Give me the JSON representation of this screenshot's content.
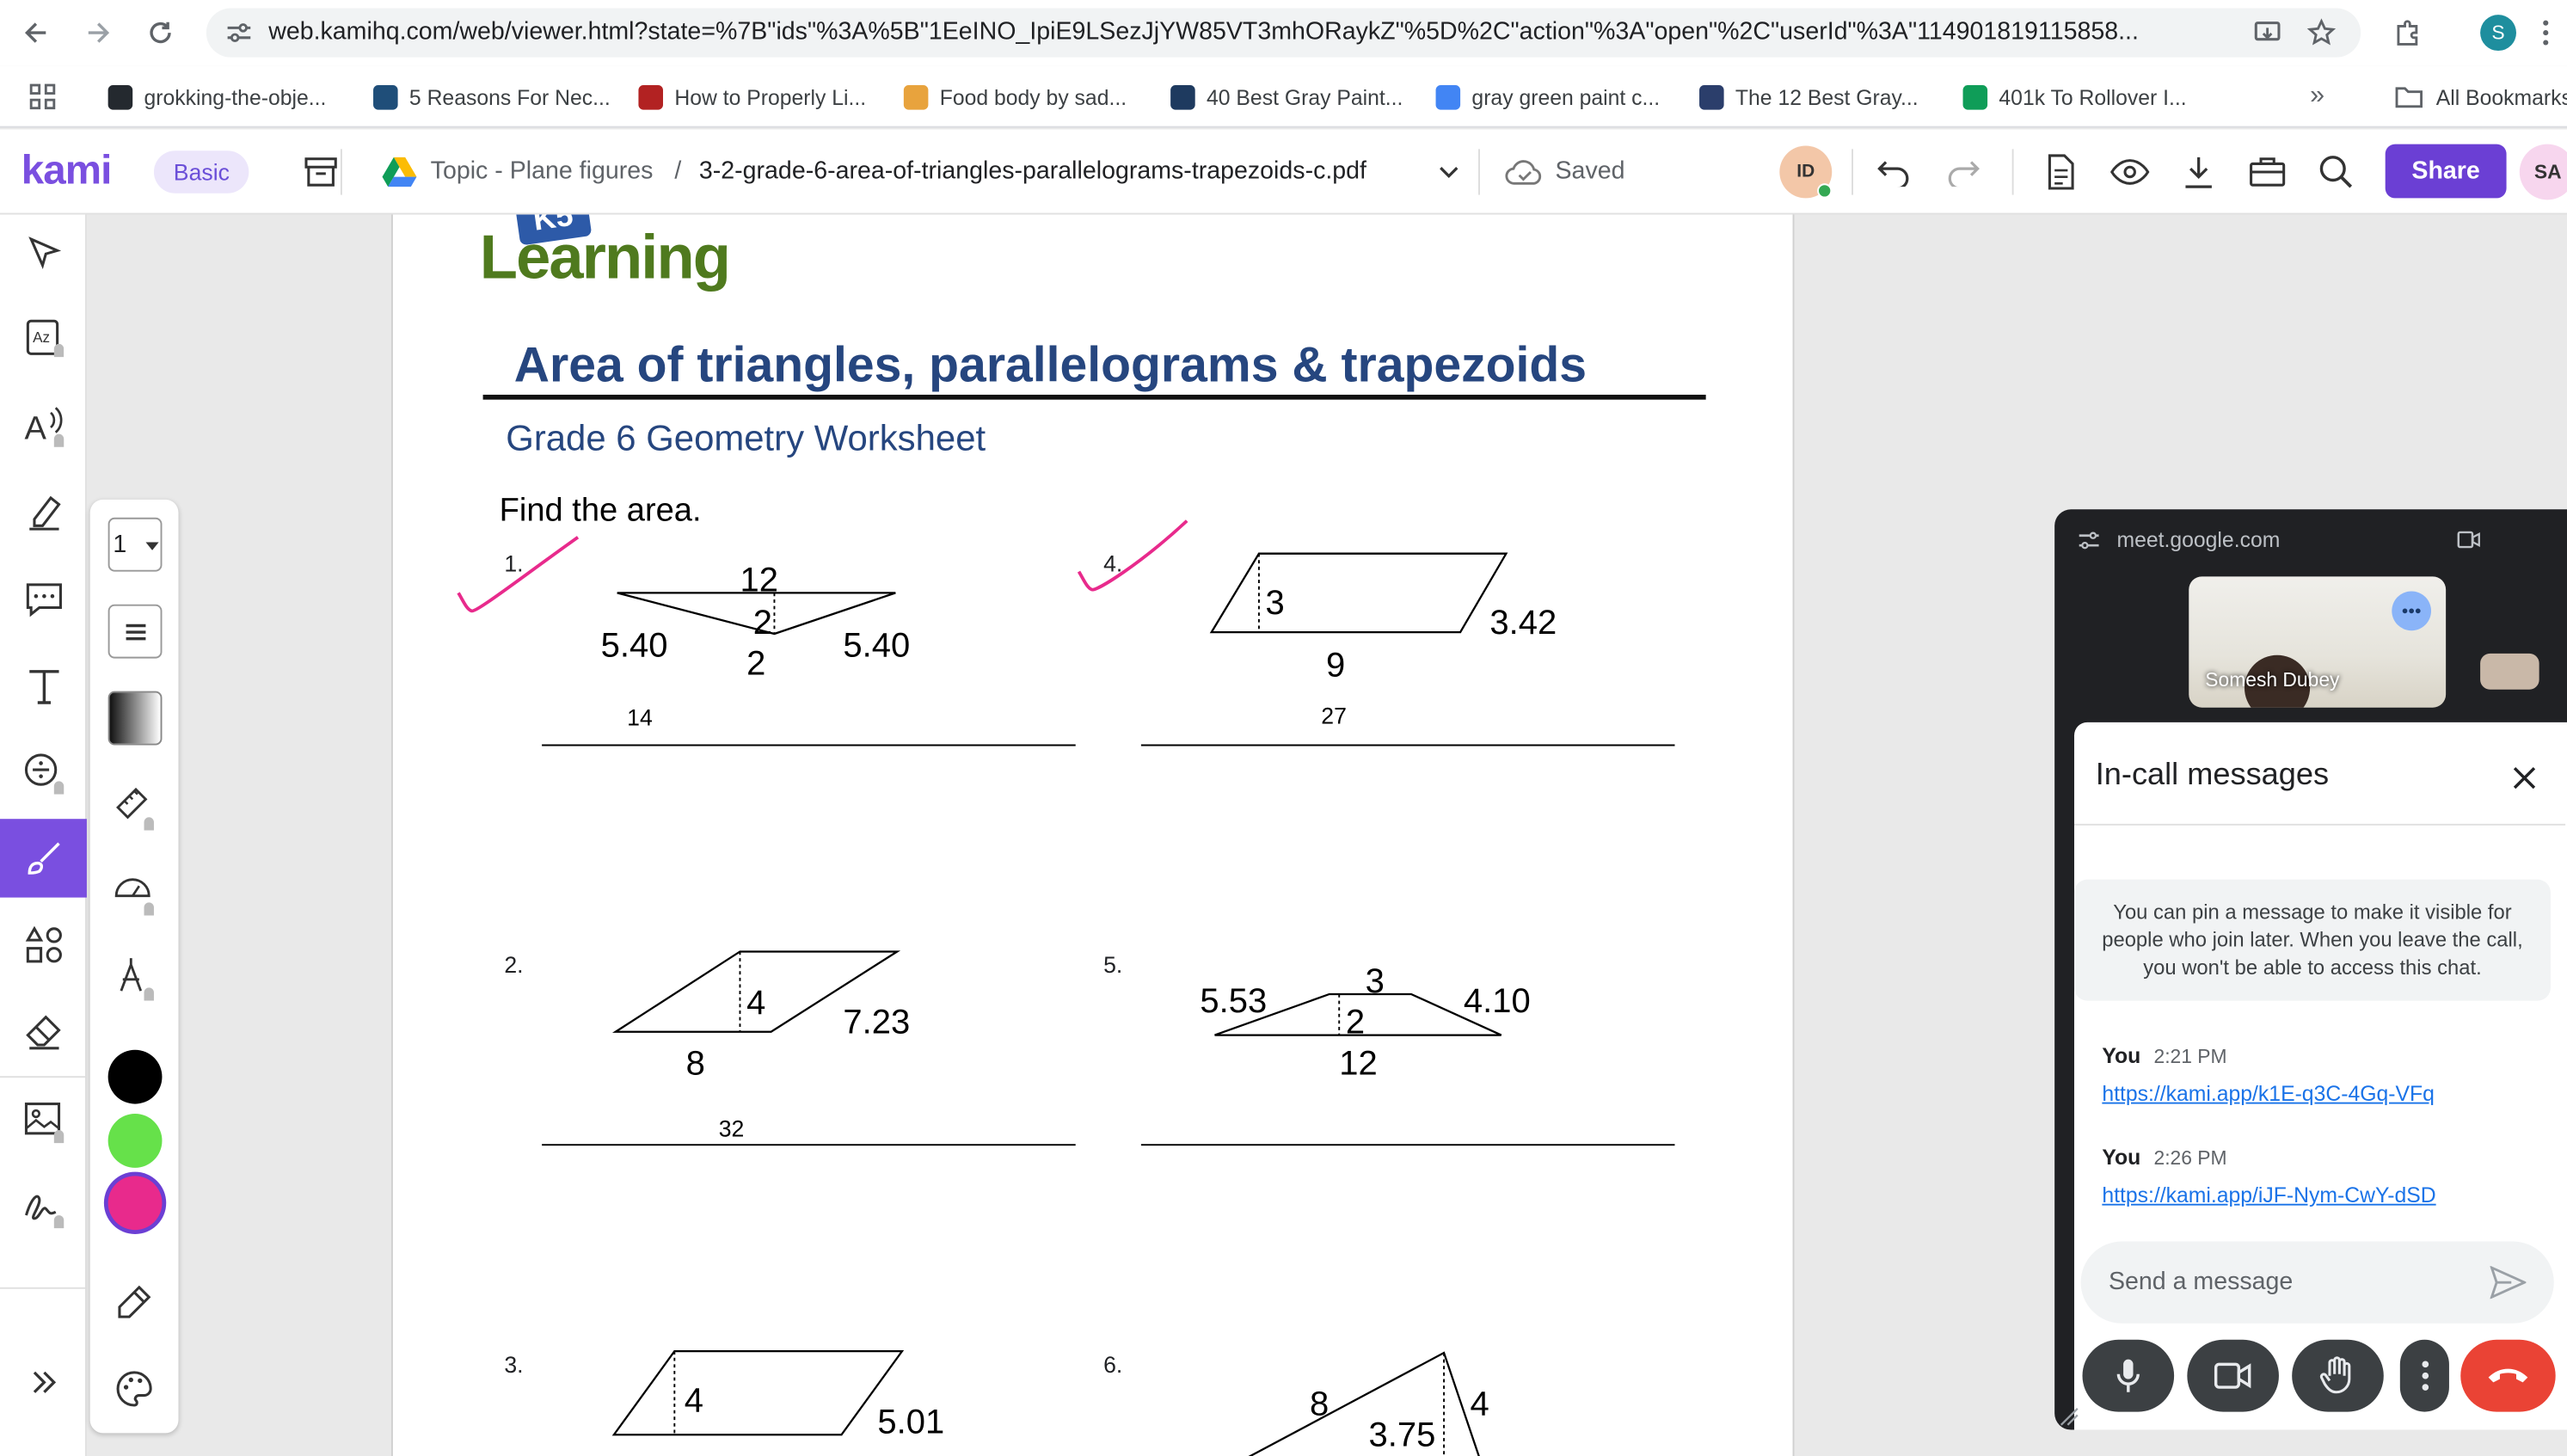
{
  "browser": {
    "url": "web.kamihq.com/web/viewer.html?state=%7B\"ids\"%3A%5B\"1EeINO_IpiE9LSezJjYW85VT3mhORaykZ\"%5D%2C\"action\"%3A\"open\"%2C\"userId\"%3A\"114901819115858...",
    "profile_initial": "S",
    "bookmarks": [
      {
        "label": "grokking-the-obje...",
        "color": "#24292f"
      },
      {
        "label": "5 Reasons For Nec...",
        "color": "#1f4e79"
      },
      {
        "label": "How to Properly Li...",
        "color": "#b22222"
      },
      {
        "label": "Food body by sad...",
        "color": "#e8a33d"
      },
      {
        "label": "40 Best Gray Paint...",
        "color": "#1e3a5f"
      },
      {
        "label": "gray green paint c...",
        "color": "#4285f4"
      },
      {
        "label": "The 12 Best Gray...",
        "color": "#2b3e6b"
      },
      {
        "label": "401k To Rollover I...",
        "color": "#0f9d58"
      }
    ],
    "all_bookmarks": "All Bookmarks"
  },
  "kami": {
    "logo": "kami",
    "plan": "Basic",
    "breadcrumb_folder": "Topic - Plane figures",
    "breadcrumb_sep": "/",
    "filename": "3-2-grade-6-area-of-triangles-parallelograms-trapezoids-c.pdf",
    "save_status": "Saved",
    "user_initials": "ID",
    "share": "Share",
    "account_initials": "SA",
    "page_selector": "1",
    "colors": {
      "accent": "#7a4fe0",
      "black": "#000000",
      "green": "#66e14a",
      "pink": "#e82a8c"
    }
  },
  "worksheet": {
    "brand": "Learning",
    "brand_badge": "K5",
    "title": "Area of triangles, parallelograms & trapezoids",
    "subtitle": "Grade 6 Geometry Worksheet",
    "instruction": "Find the area.",
    "problems": [
      {
        "num": "1.",
        "labels": [
          "12",
          "2",
          "5.40",
          "5.40",
          "2"
        ],
        "answer": "14"
      },
      {
        "num": "4.",
        "labels": [
          "3",
          "3.42",
          "9"
        ],
        "answer": "27"
      },
      {
        "num": "2.",
        "labels": [
          "4",
          "7.23",
          "8"
        ],
        "answer": "32"
      },
      {
        "num": "5.",
        "labels": [
          "5.53",
          "3",
          "4.10",
          "2",
          "12"
        ],
        "answer": ""
      },
      {
        "num": "3.",
        "labels": [
          "4",
          "5.01"
        ],
        "answer": ""
      },
      {
        "num": "6.",
        "labels": [
          "8",
          "4",
          "3.75"
        ],
        "answer": ""
      }
    ]
  },
  "meet": {
    "domain": "meet.google.com",
    "participant": "Somesh Dubey",
    "panel_title": "In-call messages",
    "pin_notice": "You can pin a message to make it visible for people who join later. When you leave the call, you won't be able to access this chat.",
    "messages": [
      {
        "sender": "You",
        "time": "2:21 PM",
        "link": "https://kami.app/k1E-q3C-4Gq-VFq"
      },
      {
        "sender": "You",
        "time": "2:26 PM",
        "link": "https://kami.app/iJF-Nym-CwY-dSD"
      }
    ],
    "input_placeholder": "Send a message"
  }
}
